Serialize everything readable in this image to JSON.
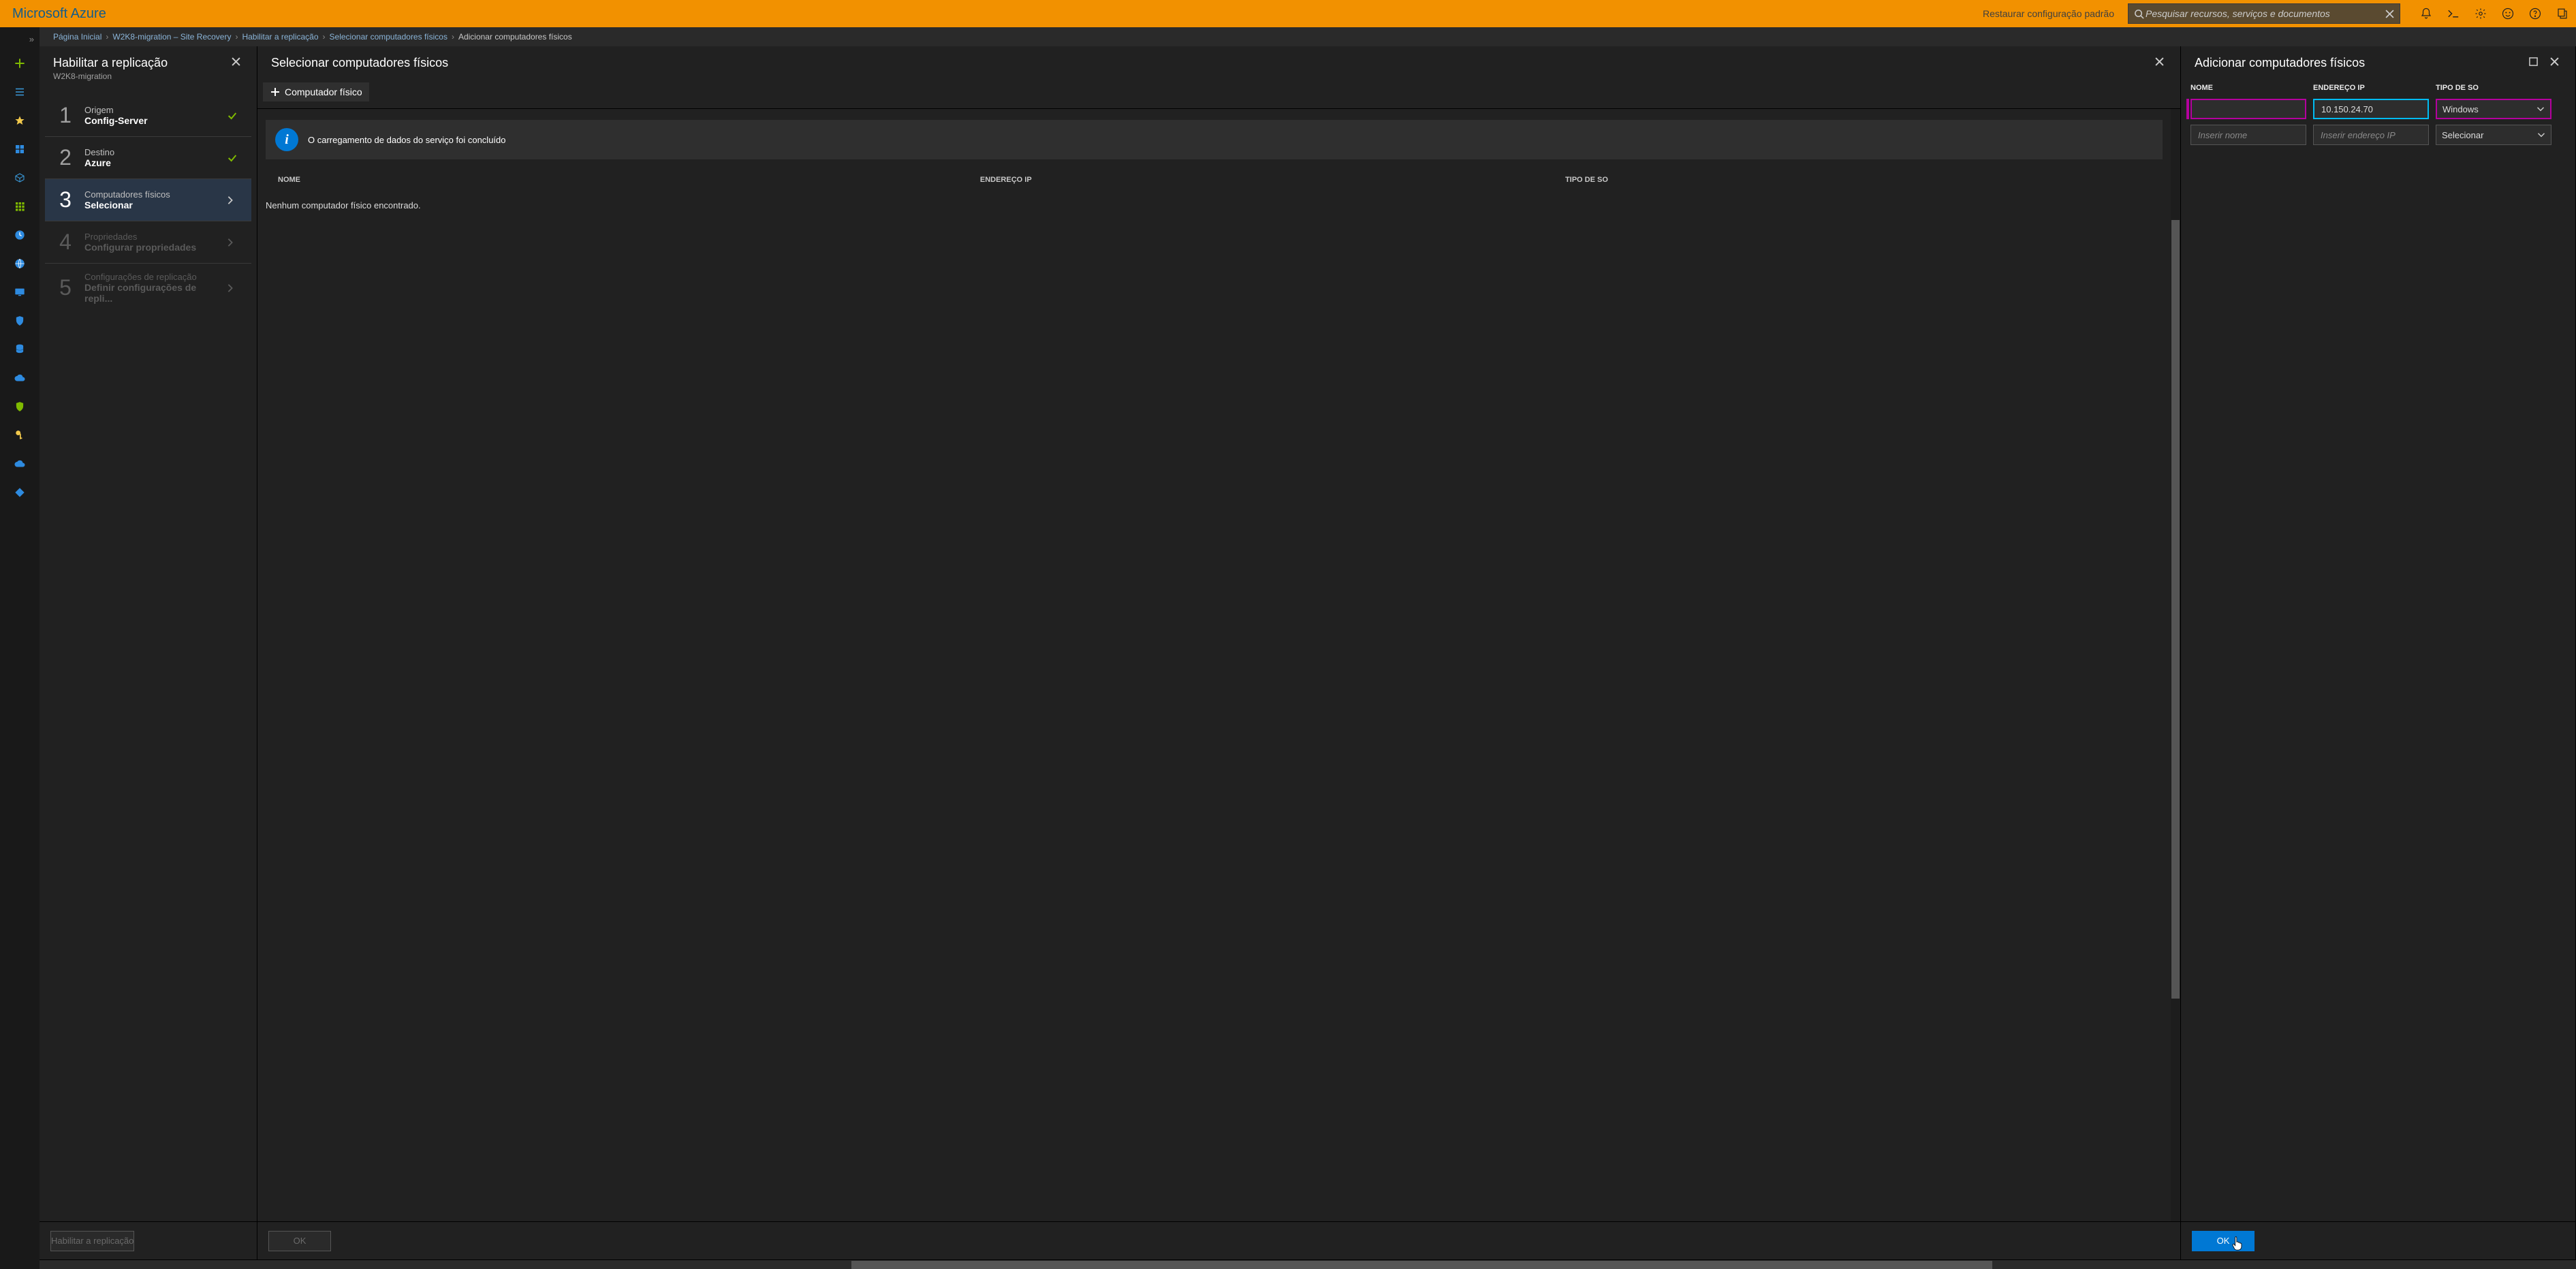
{
  "topbar": {
    "brand": "Microsoft Azure",
    "restore_default": "Restaurar configuração padrão",
    "search_placeholder": "Pesquisar recursos, serviços e documentos"
  },
  "breadcrumb": {
    "items": [
      "Página Inicial",
      "W2K8-migration – Site Recovery",
      "Habilitar a replicação",
      "Selecionar computadores físicos",
      "Adicionar computadores físicos"
    ]
  },
  "blade1": {
    "title": "Habilitar a replicação",
    "subtitle": "W2K8-migration",
    "steps": [
      {
        "num": "1",
        "l1": "Origem",
        "l2": "Config-Server",
        "state": "done"
      },
      {
        "num": "2",
        "l1": "Destino",
        "l2": "Azure",
        "state": "done"
      },
      {
        "num": "3",
        "l1": "Computadores físicos",
        "l2": "Selecionar",
        "state": "active"
      },
      {
        "num": "4",
        "l1": "Propriedades",
        "l2": "Configurar propriedades",
        "state": "disabled"
      },
      {
        "num": "5",
        "l1": "Configurações de replicação",
        "l2": "Definir configurações de repli...",
        "state": "disabled"
      }
    ],
    "footer_btn": "Habilitar a replicação"
  },
  "blade2": {
    "title": "Selecionar computadores físicos",
    "cmd_add": "Computador físico",
    "banner": "O carregamento de dados do serviço foi concluído",
    "columns": {
      "name": "NOME",
      "ip": "ENDEREÇO IP",
      "os": "TIPO DE SO"
    },
    "empty": "Nenhum computador físico encontrado.",
    "footer_btn": "OK"
  },
  "blade3": {
    "title": "Adicionar computadores físicos",
    "columns": {
      "name": "NOME",
      "ip": "ENDEREÇO IP",
      "os": "TIPO DE SO"
    },
    "rows": [
      {
        "name": "",
        "ip": "10.150.24.70",
        "os": "Windows"
      },
      {
        "name_placeholder": "Inserir nome",
        "ip_placeholder": "Inserir endereço IP",
        "os": "Selecionar"
      }
    ],
    "footer_btn": "OK"
  }
}
